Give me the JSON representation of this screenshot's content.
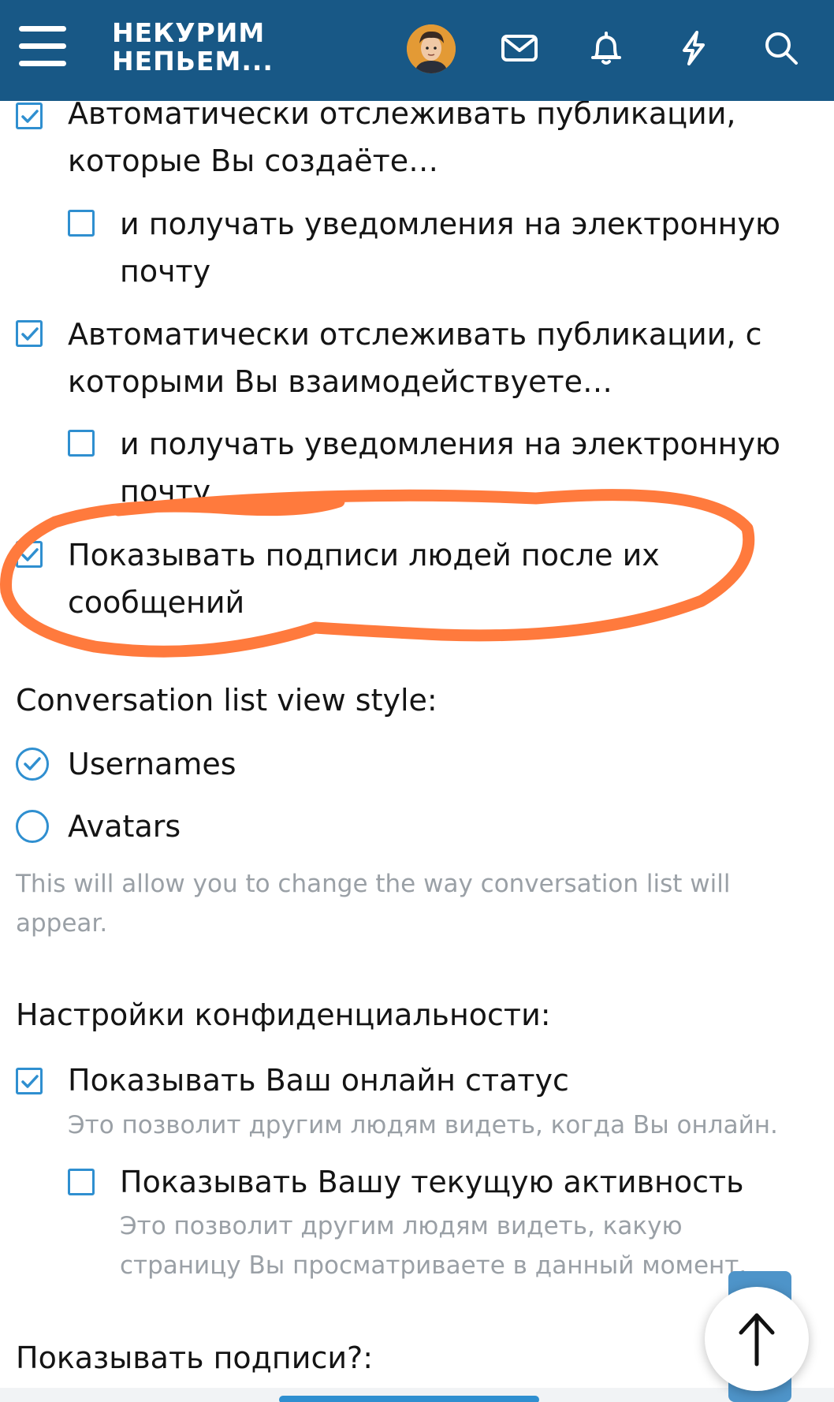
{
  "header": {
    "logo_line1": "НЕКУРИМ",
    "logo_line2": "НЕПЬЕМ...",
    "icons": [
      "menu-icon",
      "avatar",
      "mail-icon",
      "bell-icon",
      "lightning-icon",
      "search-icon"
    ],
    "bg_color": "#185886"
  },
  "prefs": {
    "auto_watch_created": {
      "label_line1": "Автоматически отслеживать публикации,",
      "label_line2": "которые Вы создаёте…",
      "checked": true
    },
    "auto_watch_created_email": {
      "label_line1": "и получать уведомления на электронную",
      "label_line2": "почту",
      "checked": false
    },
    "auto_watch_interact": {
      "label_line1": "Автоматически отслеживать публикации, с",
      "label_line2": "которыми Вы взаимодействуете…",
      "checked": true
    },
    "auto_watch_interact_email": {
      "label_line1": "и получать уведомления на электронную",
      "label_line2": "почту",
      "checked": false
    },
    "show_signatures": {
      "label_line1": "Показывать подписи людей после их",
      "label_line2": "сообщений",
      "checked": true
    }
  },
  "conversation": {
    "title": "Conversation list view style:",
    "options": [
      {
        "label": "Usernames",
        "selected": true
      },
      {
        "label": "Avatars",
        "selected": false
      }
    ],
    "hint_line1": "This will allow you to change the way conversation list will",
    "hint_line2": "appear."
  },
  "privacy": {
    "title": "Настройки конфиденциальности:",
    "online_status": {
      "label": "Показывать Ваш онлайн статус",
      "hint": "Это позволит другим людям видеть, когда Вы онлайн.",
      "checked": true
    },
    "activity": {
      "label": "Показывать Вашу текущую активность",
      "hint_line1": "Это позволит другим людям видеть, какую",
      "hint_line2": "страницу Вы просматриваете в данный момент.",
      "checked": false
    }
  },
  "signatures_question": "Показывать подписи?:",
  "scroll_top_label": "↑",
  "colors": {
    "accent": "#2f8fd0",
    "annotation": "#ff7a3d",
    "hint": "#9aa0a6"
  }
}
